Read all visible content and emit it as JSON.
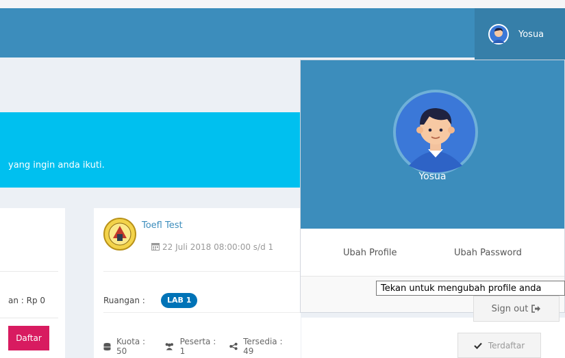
{
  "header": {
    "user_name": "Yosua",
    "brand_color": "#3c8dbc"
  },
  "callout": {
    "text": "yang ingin anda ikuti.",
    "color": "#00c0ef"
  },
  "card_left": {
    "fee_label": "an : Rp 0",
    "daftar_label": "Daftar"
  },
  "card_main": {
    "title": "Toefl Test",
    "date_text": "22 Juli 2018 08:00:00 s/d 1",
    "room_label": "Ruangan :",
    "room_badge": "LAB 1",
    "quota": "Kuota : 50",
    "participants": "Peserta : 1",
    "available": "Tersedia : 49",
    "terdaftar_label": "Terdaftar"
  },
  "dropdown": {
    "user_name": "Yosua",
    "edit_profile": "Ubah Profile",
    "change_password": "Ubah Password",
    "sign_out": "Sign out",
    "tooltip": "Tekan untuk mengubah profile anda"
  },
  "icons": {
    "avatar": "user-avatar-icon",
    "calendar": "calendar-icon",
    "quota": "database-icon",
    "participants": "users-icon",
    "available": "share-icon",
    "check": "check-icon",
    "sign_out": "sign-out-icon"
  }
}
